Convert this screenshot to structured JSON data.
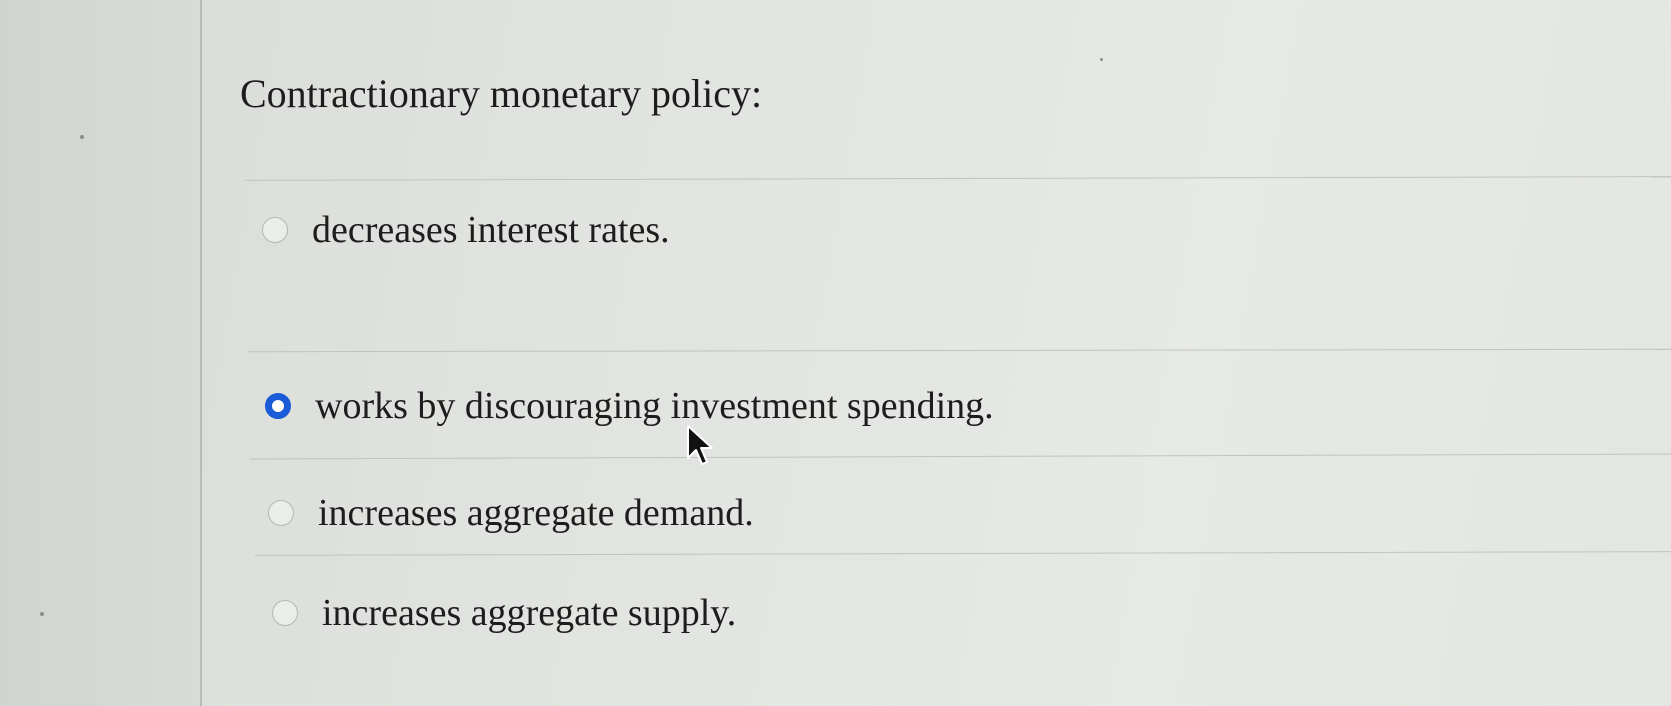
{
  "question": {
    "text": "Contractionary monetary policy:"
  },
  "options": [
    {
      "label": "decreases interest rates.",
      "selected": false
    },
    {
      "label": "works by discouraging investment spending.",
      "selected": true
    },
    {
      "label": "increases aggregate demand.",
      "selected": false
    },
    {
      "label": "increases aggregate supply.",
      "selected": false
    }
  ],
  "colors": {
    "selected_radio": "#1a5bd8",
    "background": "#e3e5e2"
  },
  "icons": {
    "pointer": "mouse-pointer-icon"
  }
}
